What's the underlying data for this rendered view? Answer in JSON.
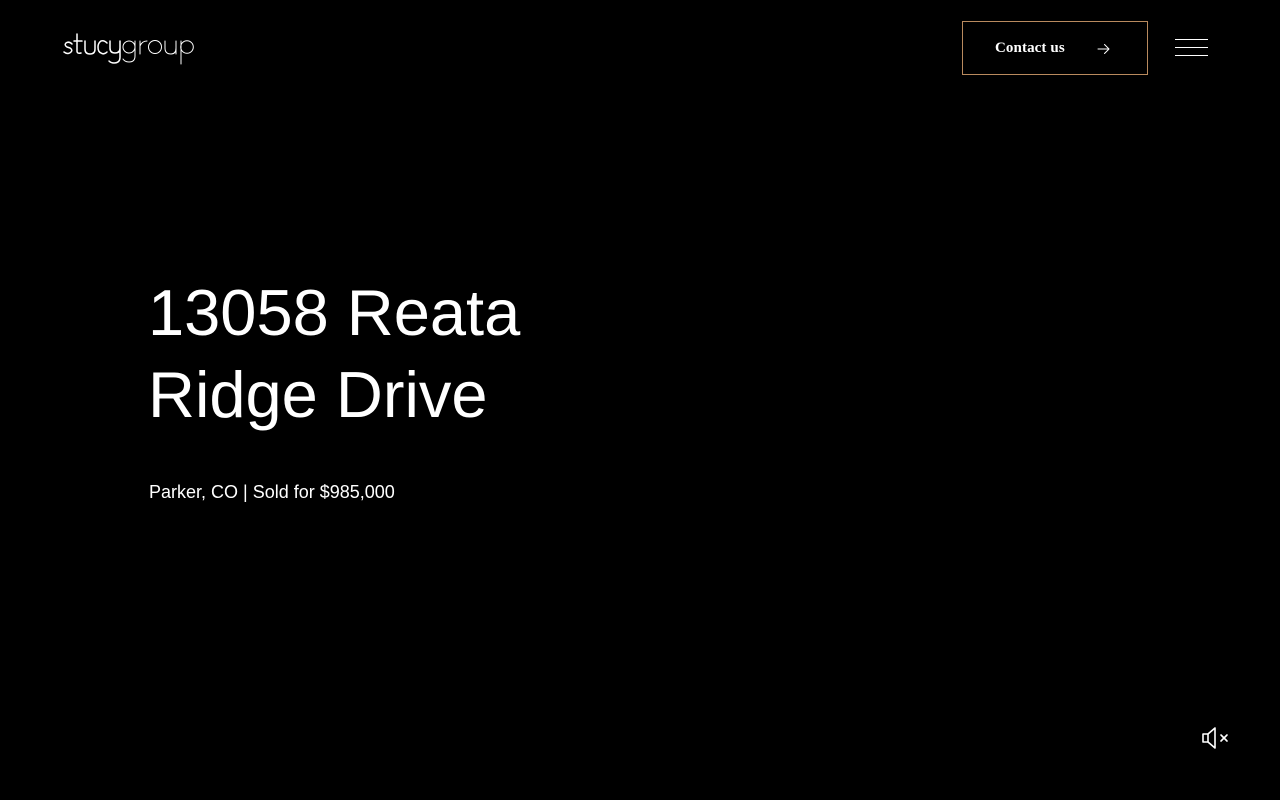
{
  "header": {
    "logo": {
      "text": "stucygroup",
      "icon": "stucygroup-logo"
    },
    "contact_button": {
      "label": "Contact us",
      "icon": "arrow-right-icon",
      "border_color": "#b98a5e"
    },
    "menu_button": {
      "icon": "hamburger-menu-icon"
    }
  },
  "hero": {
    "title_line1": "13058 Reata",
    "title_line2": "Ridge Drive",
    "subtitle": "Parker, CO | Sold for $985,000"
  },
  "video_controls": {
    "mute_button": {
      "icon": "speaker-muted-icon"
    }
  },
  "colors": {
    "background": "#000000",
    "text": "#ffffff",
    "accent": "#b98a5e"
  }
}
